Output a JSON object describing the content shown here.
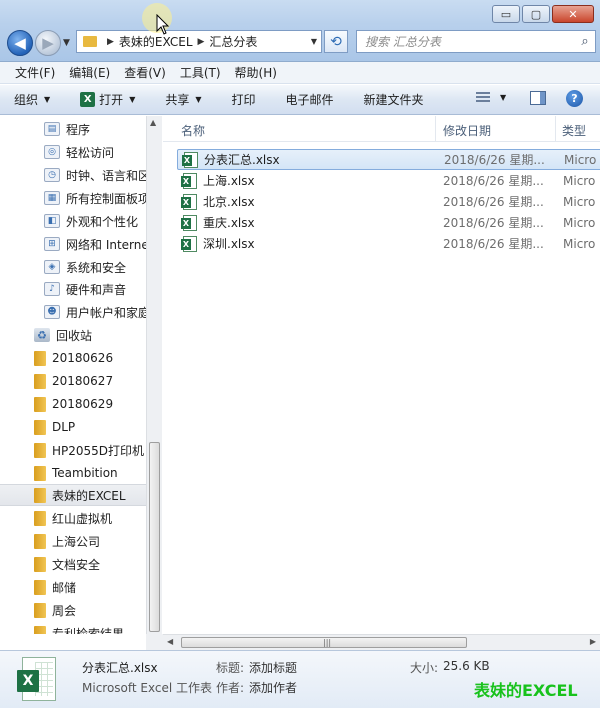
{
  "window": {
    "buttons": {
      "minimize": "▭",
      "maximize": "▢",
      "close": "✕"
    }
  },
  "address_bar": {
    "back_glyph": "◀",
    "forward_glyph": "▶",
    "path": [
      "表妹的EXCEL",
      "汇总分表"
    ],
    "search_placeholder": "搜索 汇总分表"
  },
  "menu": [
    "文件(F)",
    "编辑(E)",
    "查看(V)",
    "工具(T)",
    "帮助(H)"
  ],
  "toolbar": {
    "organize": "组织",
    "open": "打开",
    "share": "共享",
    "print": "打印",
    "email": "电子邮件",
    "new_folder": "新建文件夹",
    "help_glyph": "?"
  },
  "nav_pane": {
    "control_panel_items": [
      {
        "label": "程序",
        "icon": "programs-icon"
      },
      {
        "label": "轻松访问",
        "icon": "accessibility-icon"
      },
      {
        "label": "时钟、语言和区",
        "icon": "clock-language-icon"
      },
      {
        "label": "所有控制面板项",
        "icon": "control-panel-icon"
      },
      {
        "label": "外观和个性化",
        "icon": "appearance-icon"
      },
      {
        "label": "网络和 Interne",
        "icon": "network-icon"
      },
      {
        "label": "系统和安全",
        "icon": "system-security-icon"
      },
      {
        "label": "硬件和声音",
        "icon": "hardware-sound-icon"
      },
      {
        "label": "用户帐户和家庭",
        "icon": "user-accounts-icon"
      }
    ],
    "recycle_bin": "回收站",
    "folders": [
      "20180626",
      "20180627",
      "20180629",
      "DLP",
      "HP2055D打印机",
      "Teambition",
      "表妹的EXCEL",
      "红山虚拟机",
      "上海公司",
      "文档安全",
      "邮储",
      "周会",
      "专利检索结果"
    ],
    "selected_folder": "表妹的EXCEL"
  },
  "file_list": {
    "columns": {
      "name": "名称",
      "date": "修改日期",
      "type": "类型"
    },
    "files": [
      {
        "name": "分表汇总.xlsx",
        "date": "2018/6/26 星期...",
        "type": "Micro",
        "selected": true
      },
      {
        "name": "上海.xlsx",
        "date": "2018/6/26 星期...",
        "type": "Micro"
      },
      {
        "name": "北京.xlsx",
        "date": "2018/6/26 星期...",
        "type": "Micro"
      },
      {
        "name": "重庆.xlsx",
        "date": "2018/6/26 星期...",
        "type": "Micro"
      },
      {
        "name": "深圳.xlsx",
        "date": "2018/6/26 星期...",
        "type": "Micro"
      }
    ]
  },
  "details": {
    "file_name": "分表汇总.xlsx",
    "file_type": "Microsoft Excel 工作表",
    "title_label": "标题:",
    "title_value": "添加标题",
    "author_label": "作者:",
    "author_value": "添加作者",
    "size_label": "大小:",
    "size_value": "25.6 KB",
    "watermark": "表妹的EXCEL"
  },
  "colors": {
    "accent": "#2463b8",
    "excel_green": "#1e7145",
    "watermark": "#18c21c"
  }
}
